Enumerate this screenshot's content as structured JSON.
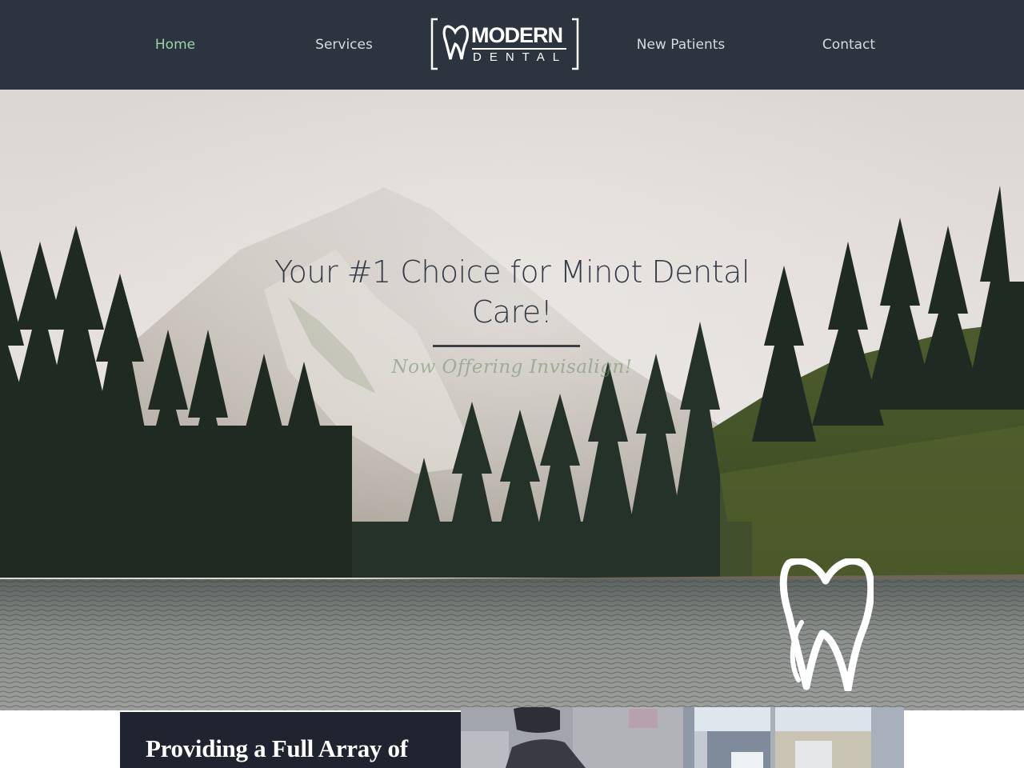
{
  "header": {
    "nav": [
      {
        "label": "Home",
        "active": true
      },
      {
        "label": "Services",
        "active": false
      },
      {
        "label": "New Patients",
        "active": false
      },
      {
        "label": "Contact",
        "active": false
      }
    ],
    "logo": {
      "line1": "MODERN",
      "line2": "DENTAL",
      "icon": "tooth-icon"
    }
  },
  "hero": {
    "title": "Your #1 Choice for Minot Dental Care!",
    "subtitle": "Now Offering Invisalign!",
    "background": "misty mountain lake with evergreen trees",
    "overlay_icon": "tooth-icon"
  },
  "intro": {
    "heading": "Providing a Full Array of",
    "photos": [
      {
        "alt": "dental exam chair"
      },
      {
        "alt": "clinic hallway"
      }
    ]
  },
  "colors": {
    "header_bg": "#2c3440",
    "nav_text": "#d7dbe0",
    "nav_active": "#9fd3a4",
    "hero_title": "#343a46",
    "subtitle_green": "#6f8f6a",
    "intro_panel_bg": "#1f2430"
  }
}
